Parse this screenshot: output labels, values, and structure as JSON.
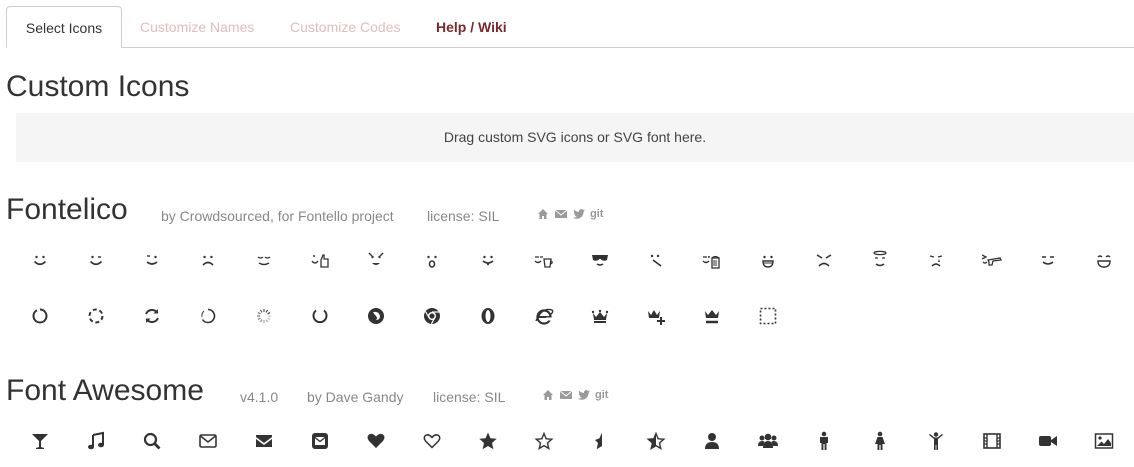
{
  "tabs": [
    {
      "label": "Select Icons",
      "active": true
    },
    {
      "label": "Customize Names",
      "active": false
    },
    {
      "label": "Customize Codes",
      "active": false
    },
    {
      "label": "Help / Wiki",
      "active": false
    }
  ],
  "custom": {
    "title": "Custom Icons",
    "dropzone_text": "Drag custom SVG icons or SVG font here."
  },
  "fontelico": {
    "title": "Fontelico",
    "author": "by Crowdsourced, for Fontello project",
    "license": "license: SIL",
    "links": [
      "home-icon",
      "mail-icon",
      "twitter-icon",
      "git"
    ],
    "icons_row1": [
      "emo-happy",
      "emo-wink",
      "emo-wink2",
      "emo-unhappy",
      "emo-sleep",
      "emo-thumbsup",
      "emo-devil",
      "emo-surprised",
      "emo-tongue",
      "emo-coffee",
      "emo-sunglasses",
      "emo-displeased",
      "emo-beer",
      "emo-grin",
      "emo-angry",
      "emo-saint",
      "emo-cry",
      "emo-shoot",
      "emo-squint",
      "emo-laugh"
    ],
    "icons_row2": [
      "spin1",
      "spin2",
      "spin3",
      "spin4",
      "spin5",
      "spin6",
      "firefox",
      "chrome",
      "opera",
      "ie",
      "crown",
      "crown-plus",
      "crown-minus",
      "marquee"
    ]
  },
  "fontawesome": {
    "title": "Font Awesome",
    "version": "v4.1.0",
    "author": "by Dave Gandy",
    "license": "license: SIL",
    "links": [
      "home-icon",
      "mail-icon",
      "twitter-icon",
      "git"
    ],
    "icons_row1": [
      "glass",
      "music",
      "search",
      "mail",
      "mail-alt",
      "mail-squared",
      "heart",
      "heart-empty",
      "star",
      "star-empty",
      "star-half",
      "star-half-alt",
      "user",
      "users",
      "male",
      "female",
      "child",
      "video",
      "videocam",
      "picture"
    ]
  },
  "colors": {
    "icon": "#333333",
    "meta": "#888888",
    "help": "#7a2a2a",
    "muted_tab": "#e3bcbc"
  }
}
